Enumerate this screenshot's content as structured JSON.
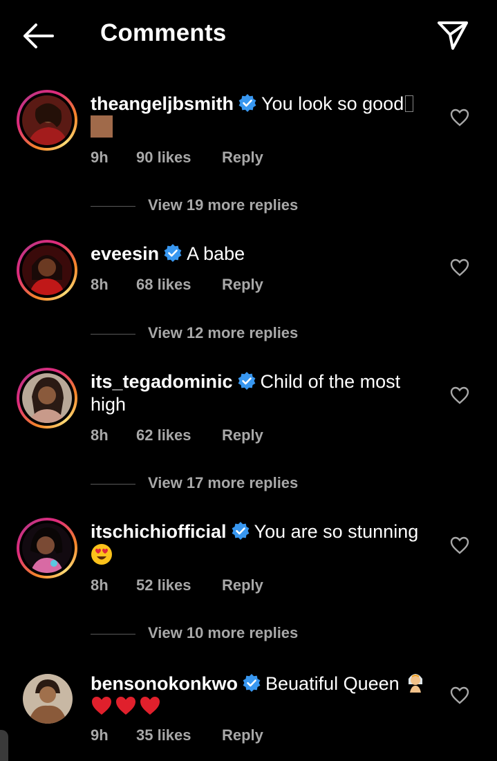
{
  "header": {
    "title": "Comments",
    "back_icon": "arrow-left-icon",
    "send_icon": "paper-plane-icon"
  },
  "colors": {
    "verified": "#3897f0",
    "meta": "#a8a8a8",
    "background": "#000000"
  },
  "comments": [
    {
      "username": "theangeljbsmith",
      "text": "You look so good",
      "time": "9h",
      "likes": "90 likes",
      "reply": "Reply",
      "view_replies": "View 19 more replies"
    },
    {
      "username": "eveesin",
      "text": "A babe",
      "time": "8h",
      "likes": "68 likes",
      "reply": "Reply",
      "view_replies": "View 12 more replies"
    },
    {
      "username": "its_tegadominic",
      "text": "Child of the most high",
      "time": "8h",
      "likes": "62 likes",
      "reply": "Reply",
      "view_replies": "View 17 more replies"
    },
    {
      "username": "itschichiofficial",
      "text": "You are so stunning",
      "time": "8h",
      "likes": "52 likes",
      "reply": "Reply",
      "view_replies": "View 10 more replies"
    },
    {
      "username": "bensonokonkwo",
      "text": "Beuatiful Queen",
      "time": "9h",
      "likes": "35 likes",
      "reply": "Reply"
    }
  ]
}
